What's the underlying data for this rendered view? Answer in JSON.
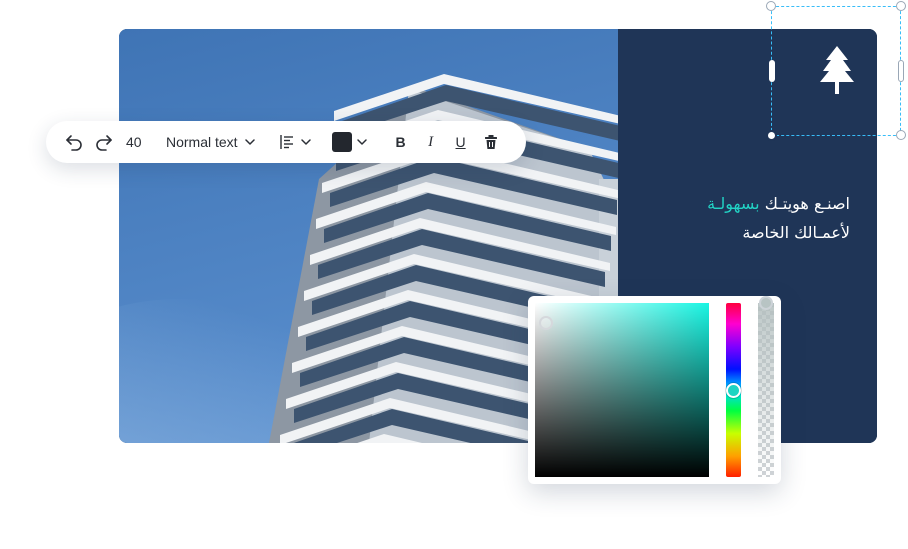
{
  "banner": {
    "headline_line1_plain": "اصنـع هويتـك ",
    "headline_line1_accent": "بسهولـة",
    "headline_line2": "لأعمـالك الخاصة",
    "accent_color": "#22d3c5",
    "panel_color": "#1f3557"
  },
  "toolbar": {
    "undo_icon": "undo-icon",
    "redo_icon": "redo-icon",
    "font_size": "40",
    "text_style": "Normal text",
    "align_icon": "align-left-icon",
    "text_color": "#23272e",
    "bold_label": "B",
    "italic_label": "I",
    "underline_label": "U",
    "delete_icon": "trash-icon"
  },
  "color_picker": {
    "base_hue_color": "#19f5e3",
    "hue_handle_color": "#1ed4c2"
  },
  "logo": {
    "icon": "tree-icon"
  }
}
